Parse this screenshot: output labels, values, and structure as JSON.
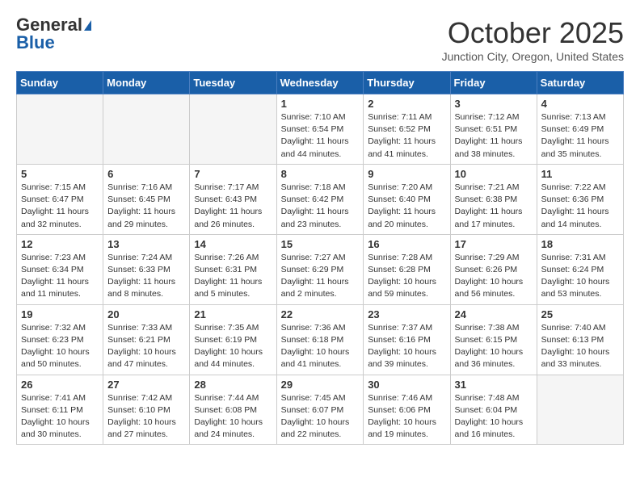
{
  "logo": {
    "general": "General",
    "blue": "Blue"
  },
  "title": "October 2025",
  "subtitle": "Junction City, Oregon, United States",
  "days_of_week": [
    "Sunday",
    "Monday",
    "Tuesday",
    "Wednesday",
    "Thursday",
    "Friday",
    "Saturday"
  ],
  "weeks": [
    [
      {
        "day": "",
        "info": ""
      },
      {
        "day": "",
        "info": ""
      },
      {
        "day": "",
        "info": ""
      },
      {
        "day": "1",
        "info": "Sunrise: 7:10 AM\nSunset: 6:54 PM\nDaylight: 11 hours and 44 minutes."
      },
      {
        "day": "2",
        "info": "Sunrise: 7:11 AM\nSunset: 6:52 PM\nDaylight: 11 hours and 41 minutes."
      },
      {
        "day": "3",
        "info": "Sunrise: 7:12 AM\nSunset: 6:51 PM\nDaylight: 11 hours and 38 minutes."
      },
      {
        "day": "4",
        "info": "Sunrise: 7:13 AM\nSunset: 6:49 PM\nDaylight: 11 hours and 35 minutes."
      }
    ],
    [
      {
        "day": "5",
        "info": "Sunrise: 7:15 AM\nSunset: 6:47 PM\nDaylight: 11 hours and 32 minutes."
      },
      {
        "day": "6",
        "info": "Sunrise: 7:16 AM\nSunset: 6:45 PM\nDaylight: 11 hours and 29 minutes."
      },
      {
        "day": "7",
        "info": "Sunrise: 7:17 AM\nSunset: 6:43 PM\nDaylight: 11 hours and 26 minutes."
      },
      {
        "day": "8",
        "info": "Sunrise: 7:18 AM\nSunset: 6:42 PM\nDaylight: 11 hours and 23 minutes."
      },
      {
        "day": "9",
        "info": "Sunrise: 7:20 AM\nSunset: 6:40 PM\nDaylight: 11 hours and 20 minutes."
      },
      {
        "day": "10",
        "info": "Sunrise: 7:21 AM\nSunset: 6:38 PM\nDaylight: 11 hours and 17 minutes."
      },
      {
        "day": "11",
        "info": "Sunrise: 7:22 AM\nSunset: 6:36 PM\nDaylight: 11 hours and 14 minutes."
      }
    ],
    [
      {
        "day": "12",
        "info": "Sunrise: 7:23 AM\nSunset: 6:34 PM\nDaylight: 11 hours and 11 minutes."
      },
      {
        "day": "13",
        "info": "Sunrise: 7:24 AM\nSunset: 6:33 PM\nDaylight: 11 hours and 8 minutes."
      },
      {
        "day": "14",
        "info": "Sunrise: 7:26 AM\nSunset: 6:31 PM\nDaylight: 11 hours and 5 minutes."
      },
      {
        "day": "15",
        "info": "Sunrise: 7:27 AM\nSunset: 6:29 PM\nDaylight: 11 hours and 2 minutes."
      },
      {
        "day": "16",
        "info": "Sunrise: 7:28 AM\nSunset: 6:28 PM\nDaylight: 10 hours and 59 minutes."
      },
      {
        "day": "17",
        "info": "Sunrise: 7:29 AM\nSunset: 6:26 PM\nDaylight: 10 hours and 56 minutes."
      },
      {
        "day": "18",
        "info": "Sunrise: 7:31 AM\nSunset: 6:24 PM\nDaylight: 10 hours and 53 minutes."
      }
    ],
    [
      {
        "day": "19",
        "info": "Sunrise: 7:32 AM\nSunset: 6:23 PM\nDaylight: 10 hours and 50 minutes."
      },
      {
        "day": "20",
        "info": "Sunrise: 7:33 AM\nSunset: 6:21 PM\nDaylight: 10 hours and 47 minutes."
      },
      {
        "day": "21",
        "info": "Sunrise: 7:35 AM\nSunset: 6:19 PM\nDaylight: 10 hours and 44 minutes."
      },
      {
        "day": "22",
        "info": "Sunrise: 7:36 AM\nSunset: 6:18 PM\nDaylight: 10 hours and 41 minutes."
      },
      {
        "day": "23",
        "info": "Sunrise: 7:37 AM\nSunset: 6:16 PM\nDaylight: 10 hours and 39 minutes."
      },
      {
        "day": "24",
        "info": "Sunrise: 7:38 AM\nSunset: 6:15 PM\nDaylight: 10 hours and 36 minutes."
      },
      {
        "day": "25",
        "info": "Sunrise: 7:40 AM\nSunset: 6:13 PM\nDaylight: 10 hours and 33 minutes."
      }
    ],
    [
      {
        "day": "26",
        "info": "Sunrise: 7:41 AM\nSunset: 6:11 PM\nDaylight: 10 hours and 30 minutes."
      },
      {
        "day": "27",
        "info": "Sunrise: 7:42 AM\nSunset: 6:10 PM\nDaylight: 10 hours and 27 minutes."
      },
      {
        "day": "28",
        "info": "Sunrise: 7:44 AM\nSunset: 6:08 PM\nDaylight: 10 hours and 24 minutes."
      },
      {
        "day": "29",
        "info": "Sunrise: 7:45 AM\nSunset: 6:07 PM\nDaylight: 10 hours and 22 minutes."
      },
      {
        "day": "30",
        "info": "Sunrise: 7:46 AM\nSunset: 6:06 PM\nDaylight: 10 hours and 19 minutes."
      },
      {
        "day": "31",
        "info": "Sunrise: 7:48 AM\nSunset: 6:04 PM\nDaylight: 10 hours and 16 minutes."
      },
      {
        "day": "",
        "info": ""
      }
    ]
  ]
}
